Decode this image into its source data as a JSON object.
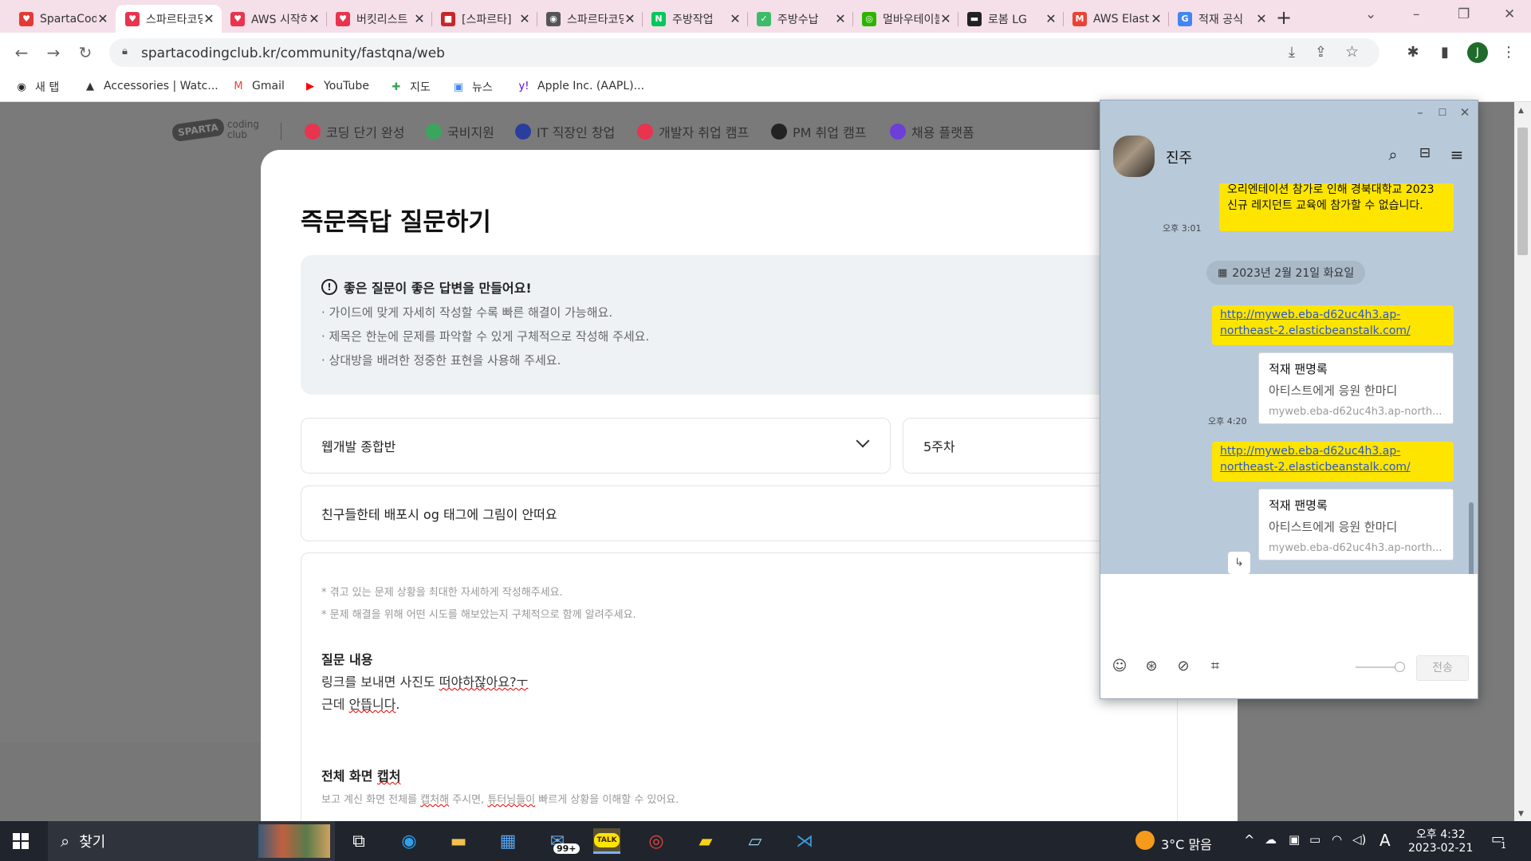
{
  "browser": {
    "tabs": [
      {
        "title": "SpartaCodingClub",
        "color": "#e53935",
        "glyph": "♥"
      },
      {
        "title": "스파르타코딩클럽",
        "color": "#e8344e",
        "glyph": "♥",
        "active": true
      },
      {
        "title": "AWS 시작하기",
        "color": "#e8344e",
        "glyph": "♥"
      },
      {
        "title": "버킷리스트",
        "color": "#e8344e",
        "glyph": "♥"
      },
      {
        "title": "[스파르타]",
        "color": "#c62828",
        "glyph": "■"
      },
      {
        "title": "스파르타코딩",
        "color": "#555555",
        "glyph": "◉"
      },
      {
        "title": "주방작업",
        "color": "#03c75a",
        "glyph": "N"
      },
      {
        "title": "주방수납",
        "color": "#3dbb6b",
        "glyph": "✓"
      },
      {
        "title": "멀바우테이블",
        "color": "#2db400",
        "glyph": "◎"
      },
      {
        "title": "로봄 LG",
        "color": "#222222",
        "glyph": "▬"
      },
      {
        "title": "AWS Elastic",
        "color": "#ea4335",
        "glyph": "M"
      },
      {
        "title": "적재 공식",
        "color": "#4285f4",
        "glyph": "G"
      }
    ],
    "new_tab": "+",
    "url": "spartacodingclub.kr/community/fastqna/web",
    "profile_initial": "J",
    "bookmarks": [
      {
        "label": "새 탭",
        "icon": "globe-icon",
        "glyph": "◉",
        "color": "#222"
      },
      {
        "label": "Accessories | Watc...",
        "icon": "shopping-bag-icon",
        "glyph": "▲",
        "color": "#333"
      },
      {
        "label": "Gmail",
        "icon": "gmail-icon",
        "glyph": "M",
        "color": "#ea4335"
      },
      {
        "label": "YouTube",
        "icon": "youtube-icon",
        "glyph": "▶",
        "color": "#ff0000"
      },
      {
        "label": "지도",
        "icon": "maps-icon",
        "glyph": "✚",
        "color": "#34a853"
      },
      {
        "label": "뉴스",
        "icon": "news-icon",
        "glyph": "▣",
        "color": "#4285f4"
      },
      {
        "label": "Apple Inc. (AAPL)...",
        "icon": "yahoo-icon",
        "glyph": "y!",
        "color": "#6001d2"
      }
    ]
  },
  "site": {
    "nav": [
      {
        "label": "코딩 단기 완성",
        "color": "#e8344e"
      },
      {
        "label": "국비지원",
        "color": "#3aa55d"
      },
      {
        "label": "IT 직장인 창업",
        "color": "#2a3f9d"
      },
      {
        "label": "개발자 취업 캠프",
        "color": "#e8344e"
      },
      {
        "label": "PM 취업 캠프",
        "color": "#222222"
      },
      {
        "label": "채용 플랫폼",
        "color": "#6b3fd8"
      }
    ],
    "logo_main": "SPARTA",
    "logo_sub": "coding club",
    "title": "즉문즉답 질문하기",
    "guide": {
      "head": "좋은 질문이 좋은 답변을 만들어요!",
      "lines": [
        "· 가이드에 맞게 자세히 작성할 수록 빠른 해결이 가능해요.",
        "· 제목은 한눈에 문제를 파악할 수 있게 구체적으로 작성해 주세요.",
        "· 상대방을 배려한 정중한 표현을 사용해 주세요."
      ]
    },
    "course_select": "웹개발 종합반",
    "week_select": "5주차",
    "question_title": "친구들한테 배포시 og 태그에 그림이 안떠요",
    "hints": [
      "* 겪고 있는 문제 상황을 최대한 자세하게 작성해주세요.",
      "* 문제 해결을 위해 어떤 시도를 해보았는지 구체적으로 함께 알려주세요."
    ],
    "content_label": "질문 내용",
    "content_line1_a": "링크를 보내면 사진도 ",
    "content_line1_b": "떠야하잖아요?ㅜ",
    "content_line2_a": "근데 ",
    "content_line2_b": "안뜹니다",
    "content_line2_c": ".",
    "capture_label_a": "전체 화면 ",
    "capture_label_b": "캡처",
    "capture_hint_a": "보고 계신 화면 전체를 ",
    "capture_hint_b": "캡처해",
    "capture_hint_c": " 주시면, ",
    "capture_hint_d": "튜터님들이",
    "capture_hint_e": " 빠르게 상황을 이해할 수 있어요."
  },
  "kakao": {
    "chat_name": "진주",
    "msg1": "오리엔테이션 참가로 인해 경북대학교 2023 신규 레지던트 교육에 참가할 수 없습니다.",
    "msg1_time": "오후 3:01",
    "date_chip": "2023년 2월 21일 화요일",
    "link": "http://myweb.eba-d62uc4h3.ap-northeast-2.elasticbeanstalk.com/",
    "card_title": "적재 팬명록",
    "card_desc": "아티스트에게 응원 한마디",
    "card_url": "myweb.eba-d62uc4h3.ap-north...",
    "time2": "오후 4:20",
    "send": "전송"
  },
  "taskbar": {
    "search": "찾기",
    "badge": "99+",
    "weather": "3°C  맑음",
    "ime": "A",
    "time": "오후 4:32",
    "date": "2023-02-21",
    "notif": "1"
  }
}
